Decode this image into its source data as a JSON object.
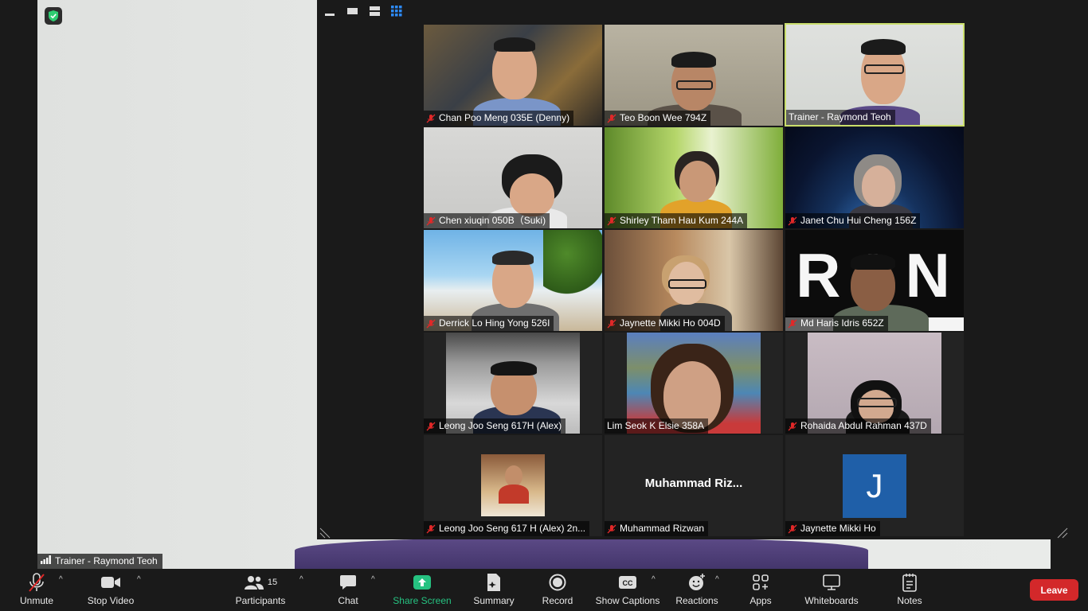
{
  "speaker_view": {
    "label": "Trainer - Raymond Teoh"
  },
  "gallery": {
    "tiles": [
      {
        "name": "Chan Poo Meng 035E (Denny)",
        "muted": true
      },
      {
        "name": "Teo Boon Wee 794Z",
        "muted": true
      },
      {
        "name": "Trainer - Raymond Teoh",
        "muted": false,
        "active": true
      },
      {
        "name": "Chen xiuqin 050B（Suki)",
        "muted": true
      },
      {
        "name": "Shirley Tham Hau Kum 244A",
        "muted": true
      },
      {
        "name": "Janet Chu Hui Cheng 156Z",
        "muted": true
      },
      {
        "name": "Derrick Lo Hing Yong 526I",
        "muted": true
      },
      {
        "name": "Jaynette Mikki Ho 004D",
        "muted": true
      },
      {
        "name": "Md Haris Idris 652Z",
        "muted": true
      },
      {
        "name": "Leong Joo Seng 617H (Alex)",
        "muted": true
      },
      {
        "name": "Lim Seok K Elsie 358A",
        "muted": false
      },
      {
        "name": "Rohaida Abdul Rahman 437D",
        "muted": true
      },
      {
        "name": "Leong Joo Seng 617 H (Alex) 2n...",
        "muted": true
      },
      {
        "name": "Muhammad Rizwan",
        "muted": true,
        "display_name": "Muhammad  Riz..."
      },
      {
        "name": "Jaynette Mikki Ho",
        "muted": true,
        "avatar_letter": "J"
      }
    ],
    "backdrop_text": "R I N M"
  },
  "toolbar": {
    "unmute": "Unmute",
    "stop_video": "Stop Video",
    "participants": "Participants",
    "participants_count": "15",
    "chat": "Chat",
    "share_screen": "Share Screen",
    "summary": "Summary",
    "record": "Record",
    "show_captions": "Show Captions",
    "reactions": "Reactions",
    "apps": "Apps",
    "whiteboards": "Whiteboards",
    "notes": "Notes",
    "leave": "Leave"
  },
  "colors": {
    "share_green": "#26c281",
    "leave_red": "#d3282a",
    "active_border": "#c9de6c",
    "avatar_blue": "#1f5fa8"
  }
}
